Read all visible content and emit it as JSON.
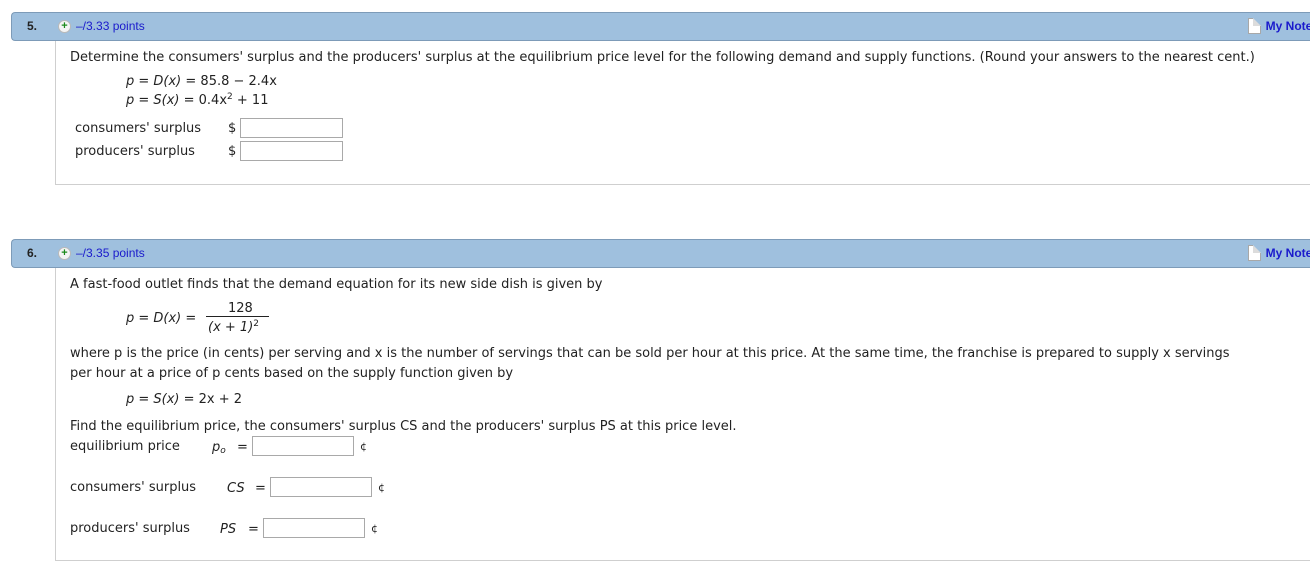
{
  "questions": [
    {
      "number": "5.",
      "points": "–/3.33 points",
      "notes_label": "My Notes",
      "prompt": "Determine the consumers' surplus and the producers' surplus at the equilibrium price level for the following demand and supply functions. (Round your answers to the nearest cent.)",
      "demand": {
        "lhs": "p = D(x) = ",
        "rhs": "85.8 − 2.4x"
      },
      "supply": {
        "lhs": "p = S(x) = ",
        "rhs_base": "0.4x",
        "rhs_exp": "2",
        "rhs_tail": " + 11"
      },
      "fields": [
        {
          "label": "consumers' surplus",
          "unit": "$",
          "value": ""
        },
        {
          "label": "producers' surplus",
          "unit": "$",
          "value": ""
        }
      ]
    },
    {
      "number": "6.",
      "points": "–/3.35 points",
      "notes_label": "My Notes",
      "intro": "A fast-food outlet finds that the demand equation for its new side dish is given by",
      "demand": {
        "lhs": "p = D(x) = ",
        "numerator": "128",
        "denominator": "(x + 1)",
        "denominator_exp": "2"
      },
      "where_line1": "where p is the price (in cents) per serving and x is the number of servings that can be sold per hour at this price. At the same time, the franchise is prepared to supply x servings",
      "where_line2": "per hour at a price of p cents based on the supply function given by",
      "supply": {
        "lhs": "p = S(x) = ",
        "rhs": "2x + 2"
      },
      "find": "Find the equilibrium price, the consumers' surplus CS and the producers' surplus PS at this price level.",
      "fields": [
        {
          "label": "equilibrium price",
          "symbol": "p",
          "symbol_sub": "o",
          "eq": "=",
          "unit": "¢",
          "value": ""
        },
        {
          "label": "consumers' surplus",
          "symbol": "CS",
          "eq": "=",
          "unit": "¢",
          "value": ""
        },
        {
          "label": "producers' surplus",
          "symbol": "PS",
          "eq": "=",
          "unit": "¢",
          "value": ""
        }
      ]
    }
  ]
}
